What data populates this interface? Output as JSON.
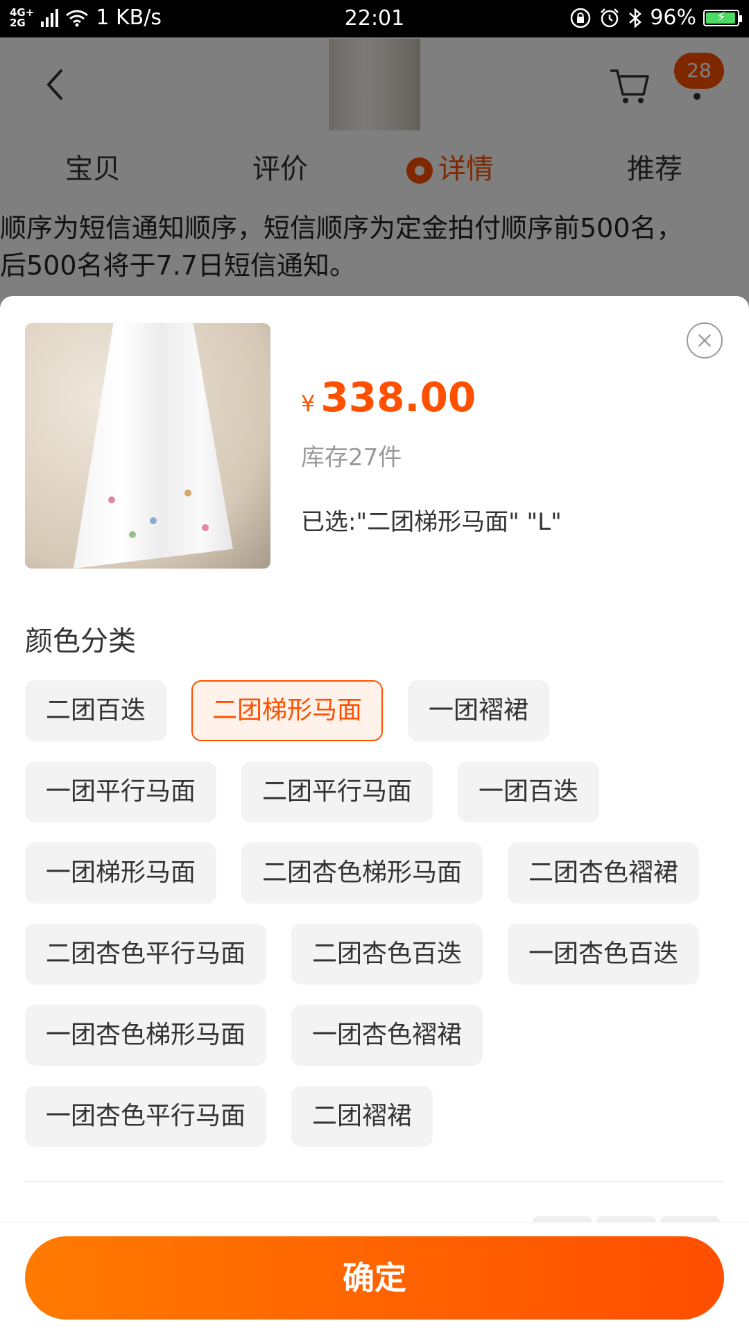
{
  "status_bar": {
    "network": "4G+\n2G",
    "speed": "1 KB/s",
    "time": "22:01",
    "battery": "96%",
    "battery_level": 0.96
  },
  "header": {
    "cart_count": "28"
  },
  "tabs": [
    {
      "label": "宝贝"
    },
    {
      "label": "评价"
    },
    {
      "label": "详情"
    },
    {
      "label": "推荐"
    }
  ],
  "notice": {
    "line1": "顺序为短信通知顺序，短信顺序为定金拍付顺序前500名，",
    "line2": "后500名将于7.7日短信通知。"
  },
  "sku": {
    "currency": "¥",
    "price": "338.00",
    "stock": "库存27件",
    "selected": "已选:\"二团梯形马面\" \"L\"",
    "section_title": "颜色分类",
    "options": [
      "二团百迭",
      "二团梯形马面",
      "一团褶裙",
      "一团平行马面",
      "二团平行马面",
      "一团百迭",
      "一团梯形马面",
      "二团杏色梯形马面",
      "二团杏色褶裙",
      "二团杏色平行马面",
      "二团杏色百迭",
      "一团杏色百迭",
      "一团杏色梯形马面",
      "一团杏色褶裙",
      "一团杏色平行马面",
      "二团褶裙"
    ],
    "selected_option": "二团梯形马面",
    "confirm_label": "确定"
  },
  "colors": {
    "accent": "#ff5000",
    "option_bg": "#f3f3f3"
  }
}
